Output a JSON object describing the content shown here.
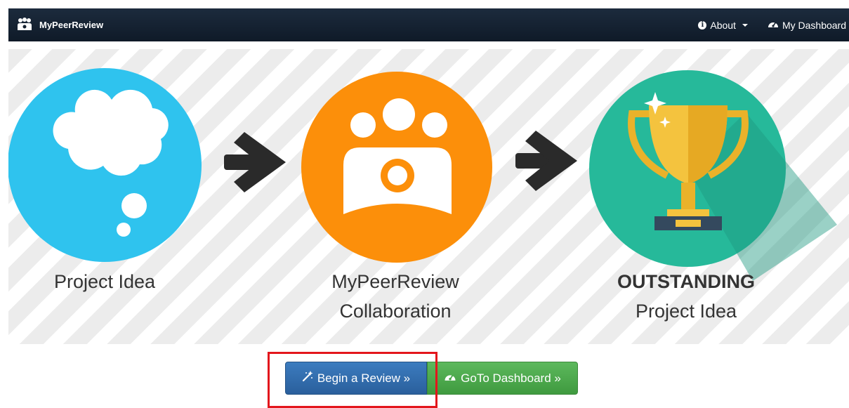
{
  "navbar": {
    "brand": "MyPeerReview",
    "brand_icon": "group-icon",
    "about": "About",
    "dashboard": "My Dashboard"
  },
  "steps": [
    {
      "icon": "thought-cloud-icon",
      "color": "#2fc3ee",
      "label_lines": [
        "Project Idea"
      ]
    },
    {
      "icon": "users-group-icon",
      "color": "#fc8f0a",
      "label_lines": [
        "MyPeerReview",
        "Collaboration"
      ]
    },
    {
      "icon": "trophy-icon",
      "color": "#26b99a",
      "label_lines": [
        "OUTSTANDING",
        "Project Idea"
      ]
    }
  ],
  "buttons": {
    "begin_review": "Begin a Review »",
    "goto_dashboard": "GoTo Dashboard »"
  },
  "colors": {
    "navbar": "#15212f",
    "primary": "#337ab7",
    "success": "#4cae4c",
    "highlight": "#e3161c",
    "arrow": "#2a2a2a"
  }
}
